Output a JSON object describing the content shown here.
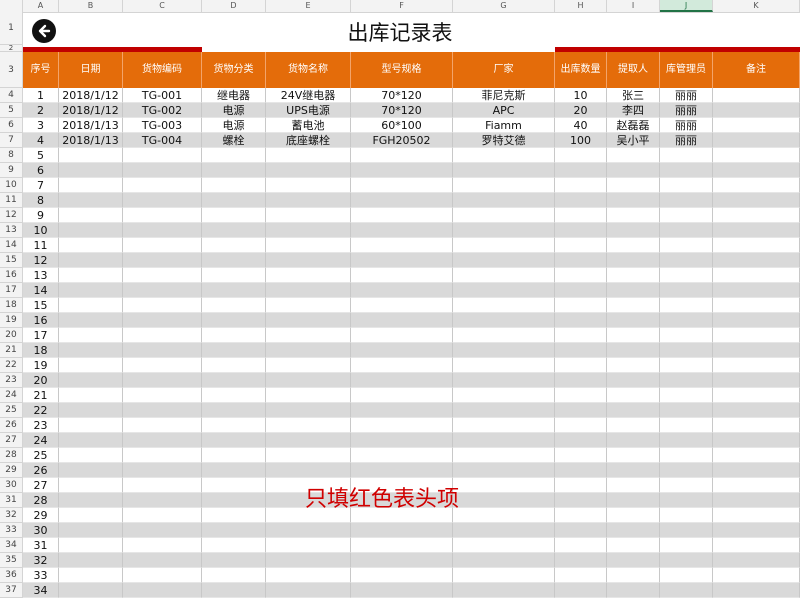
{
  "sheet": {
    "columns": [
      "A",
      "B",
      "C",
      "D",
      "E",
      "F",
      "G",
      "H",
      "I",
      "J",
      "K"
    ],
    "selected_column": "J",
    "title": "出库记录表",
    "headers": [
      "序号",
      "日期",
      "货物编码",
      "货物分类",
      "货物名称",
      "型号规格",
      "厂家",
      "出库数量",
      "提取人",
      "库管理员",
      "备注"
    ],
    "rows": [
      [
        "1",
        "2018/1/12",
        "TG-001",
        "继电器",
        "24V继电器",
        "70*120",
        "菲尼克斯",
        "10",
        "张三",
        "丽丽",
        ""
      ],
      [
        "2",
        "2018/1/12",
        "TG-002",
        "电源",
        "UPS电源",
        "70*120",
        "APC",
        "20",
        "李四",
        "丽丽",
        ""
      ],
      [
        "3",
        "2018/1/13",
        "TG-003",
        "电源",
        "蓄电池",
        "60*100",
        "Fiamm",
        "40",
        "赵磊磊",
        "丽丽",
        ""
      ],
      [
        "4",
        "2018/1/13",
        "TG-004",
        "螺栓",
        "底座螺栓",
        "FGH20502",
        "罗特艾德",
        "100",
        "吴小平",
        "丽丽",
        ""
      ]
    ],
    "empty_seq_start": 5,
    "empty_seq_end": 34,
    "row_numbers": [
      "1",
      "2",
      "3",
      "4",
      "5",
      "6",
      "7",
      "8",
      "9",
      "10",
      "11",
      "12",
      "13",
      "14",
      "15",
      "16",
      "17",
      "18",
      "19",
      "20",
      "21",
      "22",
      "23",
      "24",
      "25",
      "26",
      "27",
      "28",
      "29",
      "30",
      "31",
      "32",
      "33",
      "34",
      "35",
      "36",
      "37"
    ],
    "note": "只填红色表头项"
  },
  "colors": {
    "header_bg": "#e46c0a",
    "red_bar": "#c00000",
    "stripe": "#d9d9d9",
    "note": "#d00000"
  },
  "icons": {
    "back": "circle-arrow-left-icon"
  }
}
